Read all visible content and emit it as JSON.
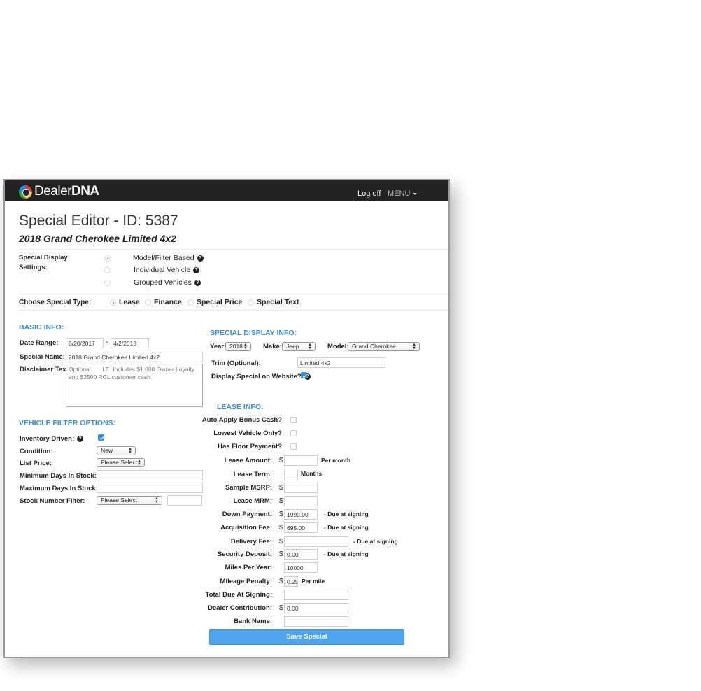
{
  "nav": {
    "logo_part1": "Dealer",
    "logo_part2": "DNA",
    "logoff": "Log off",
    "menu": "MENU"
  },
  "page": {
    "title": "Special Editor - ID: 5387",
    "subtitle": "2018 Grand Cherokee Limited 4x2"
  },
  "display_settings": {
    "label_line1": "Special Display",
    "label_line2": "Settings:",
    "options": [
      "Model/Filter Based",
      "Individual Vehicle",
      "Grouped Vehicles"
    ],
    "selected": "Model/Filter Based"
  },
  "special_type": {
    "label": "Choose Special Type:",
    "options": [
      "Lease",
      "Finance",
      "Special Price",
      "Special Text"
    ],
    "selected": "Lease"
  },
  "basic_info": {
    "heading": "BASIC INFO:",
    "date_range_label": "Date Range:",
    "date_start": "6/20/2017",
    "date_sep": "-",
    "date_end": "4/2/2018",
    "special_name_label": "Special Name:",
    "special_name": "2018 Grand Cherokee Limited 4x2",
    "disclaimer_label": "Disclaimer Text:",
    "disclaimer": "Optional.      I.E. Includes $1,000 Owner Loyalty and $2500 RCL customer cash."
  },
  "display_info": {
    "heading": "SPECIAL DISPLAY INFO:",
    "year_label": "Year:",
    "year": "2018",
    "make_label": "Make:",
    "make": "Jeep",
    "model_label": "Model:",
    "model": "Grand Cherokee",
    "trim_label": "Trim (Optional):",
    "trim": "Limited 4x2",
    "display_on_website_label": "Display Special on Website?",
    "display_on_website": true
  },
  "vehicle_filter": {
    "heading": "VEHICLE FILTER OPTIONS:",
    "inventory_driven_label": "Inventory Driven:",
    "inventory_driven": true,
    "condition_label": "Condition:",
    "condition": "New",
    "list_price_label": "List Price:",
    "list_price": "Please Select",
    "min_days_label": "Minimum Days In Stock:",
    "max_days_label": "Maximum Days In Stock:",
    "stock_filter_label": "Stock Number Filter:",
    "stock_filter": "Please Select"
  },
  "lease_info": {
    "heading": "LEASE INFO:",
    "currency": "$",
    "checks": [
      {
        "label": "Auto Apply Bonus Cash?",
        "checked": false
      },
      {
        "label": "Lowest Vehicle Only?",
        "checked": false
      },
      {
        "label": "Has Floor Payment?",
        "checked": false
      }
    ],
    "lease_amount_label": "Lease Amount:",
    "lease_amount_suffix": "Per month",
    "lease_term_label": "Lease Term:",
    "lease_term_suffix": "Months",
    "sample_msrp_label": "Sample MSRP:",
    "lease_mrm_label": "Lease MRM:",
    "down_payment_label": "Down Payment:",
    "down_payment": "1999.00",
    "due_at_signing": "- Due at signing",
    "acquisition_fee_label": "Acquisition Fee:",
    "acquisition_fee": "695.00",
    "delivery_fee_label": "Delivery Fee:",
    "security_deposit_label": "Security Deposit:",
    "security_deposit": "0.00",
    "miles_per_year_label": "Miles Per Year:",
    "miles_per_year": "10000",
    "mileage_penalty_label": "Mileage Penalty:",
    "mileage_penalty": "0.25",
    "mileage_penalty_suffix": "Per mile",
    "total_due_label": "Total Due At Signing:",
    "dealer_contribution_label": "Dealer Contribution:",
    "dealer_contribution": "0.00",
    "bank_name_label": "Bank Name:"
  },
  "actions": {
    "save": "Save Special"
  },
  "colors": {
    "accent": "#3a8fd6",
    "navbar": "#222222",
    "button": "#4fa3ec"
  }
}
